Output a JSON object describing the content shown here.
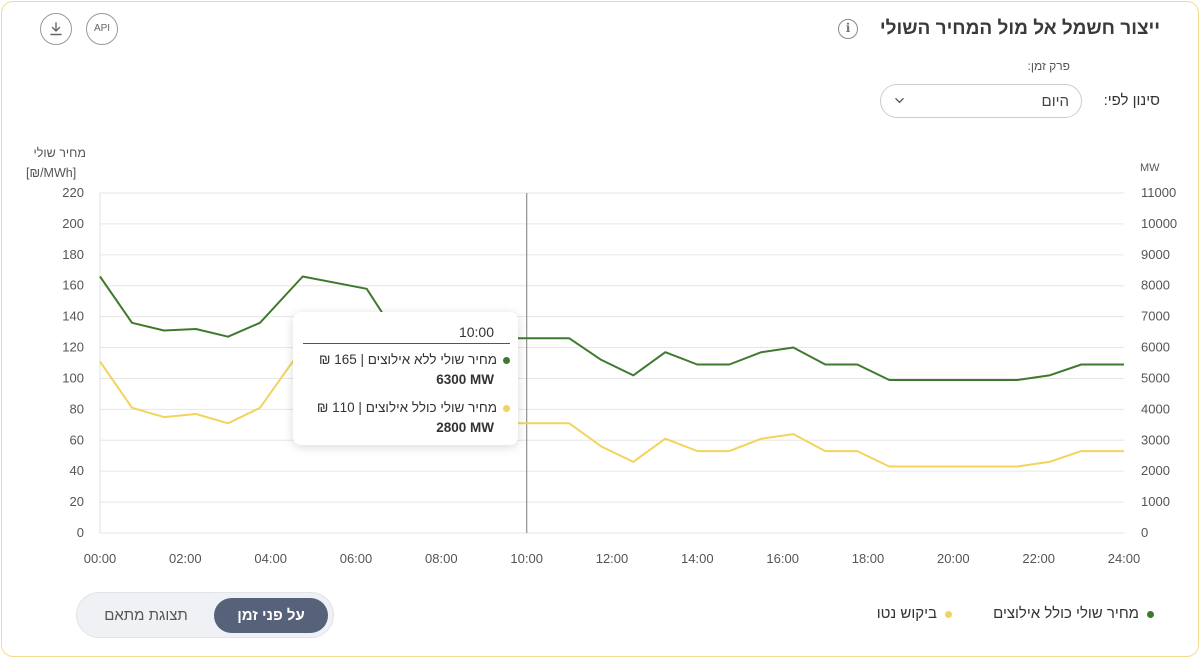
{
  "header": {
    "title": "ייצור חשמל אל מול המחיר השולי",
    "info_icon": "info-icon",
    "download_icon": "download-icon",
    "api_label": "API"
  },
  "filters": {
    "period_label": "פרק זמן:",
    "filter_label": "סינון לפי:",
    "selected_value": "היום"
  },
  "view_toggle": {
    "active_label": "על פני זמן",
    "inactive_label": "תצוגת מתאם"
  },
  "legend": [
    {
      "label": "מחיר שולי כולל אילוצים",
      "color": "#3e7a2e"
    },
    {
      "label": "ביקוש נטו",
      "color": "#f2d45c"
    }
  ],
  "tooltip": {
    "time": "10:00",
    "rows": [
      {
        "label": "מחיר שולי ללא אילוצים",
        "value": "165 ₪",
        "mw": "6300 MW",
        "color": "#3e7a2e"
      },
      {
        "label": "מחיר שולי כולל אילוצים",
        "value": "110 ₪",
        "mw": "2800 MW",
        "color": "#f2d45c"
      }
    ]
  },
  "chart_data": {
    "type": "line",
    "left_axis_title": "מחיר שולי",
    "left_axis_unit": "[₪/MWh]",
    "right_axis_unit": "MW",
    "left_ylim": [
      0,
      220
    ],
    "left_ticks": [
      0,
      20,
      40,
      60,
      80,
      100,
      120,
      140,
      160,
      180,
      200,
      220
    ],
    "right_ylim": [
      0,
      11000
    ],
    "right_ticks": [
      0,
      1000,
      2000,
      3000,
      4000,
      5000,
      6000,
      7000,
      8000,
      9000,
      10000,
      11000
    ],
    "xlim": [
      0,
      24
    ],
    "x_ticks": [
      "00:00",
      "02:00",
      "04:00",
      "06:00",
      "08:00",
      "10:00",
      "12:00",
      "14:00",
      "16:00",
      "18:00",
      "20:00",
      "22:00",
      "24:00"
    ],
    "x_hours": [
      0,
      0.75,
      1.5,
      2.25,
      3.0,
      3.75,
      4.75,
      6.25,
      7.0,
      8.0,
      9.0,
      10.0,
      11.0,
      11.75,
      12.5,
      13.25,
      14.0,
      14.75,
      15.5,
      16.25,
      17.0,
      17.75,
      18.5,
      19.25,
      20.0,
      20.75,
      21.5,
      22.25,
      23.0,
      24.0
    ],
    "grid": true,
    "cursor_time": "10:00",
    "series": [
      {
        "name": "מחיר שולי כולל אילוצים",
        "color": "#3e7a2e",
        "values": [
          166,
          136,
          131,
          132,
          127,
          136,
          166,
          158,
          126,
          126,
          126,
          126,
          126,
          112,
          102,
          117,
          109,
          109,
          117,
          120,
          109,
          109,
          99,
          99,
          99,
          99,
          99,
          102,
          109,
          109
        ]
      },
      {
        "name": "ביקוש נטו",
        "color": "#f2d45c",
        "values": [
          111,
          81,
          75,
          77,
          71,
          81,
          120,
          110,
          71,
          71,
          71,
          71,
          71,
          56,
          46,
          61,
          53,
          53,
          61,
          64,
          53,
          53,
          43,
          43,
          43,
          43,
          43,
          46,
          53,
          53
        ]
      }
    ]
  }
}
